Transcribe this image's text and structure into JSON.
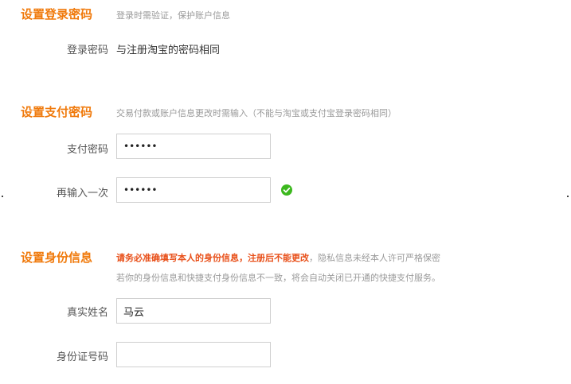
{
  "login": {
    "title": "设置登录密码",
    "hint": "登录时需验证，保护账户信息",
    "label": "登录密码",
    "value": "与注册淘宝的密码相同"
  },
  "payment": {
    "title": "设置支付密码",
    "hint": "交易付款或账户信息更改时需输入（不能与淘宝或支付宝登录密码相同）",
    "pay_label": "支付密码",
    "pay_value": "••••••",
    "confirm_label": "再输入一次",
    "confirm_value": "••••••",
    "confirm_status_icon": "check-circle-icon",
    "status_color": "#3cb81e"
  },
  "identity": {
    "title": "设置身份信息",
    "warning": "请务必准确填写本人的身份信息，注册后不能更改",
    "hint_rest": "，隐私信息未经本人许可严格保密",
    "hint_line2": "若你的身份信息和快捷支付身份信息不一致，将会自动关闭已开通的快捷支付服务。",
    "name_label": "真实姓名",
    "name_value": "马云",
    "id_label": "身份证号码",
    "id_value": ""
  },
  "colors": {
    "accent": "#f07a0c",
    "warning": "#e8501a",
    "hint": "#9a9a9a"
  }
}
